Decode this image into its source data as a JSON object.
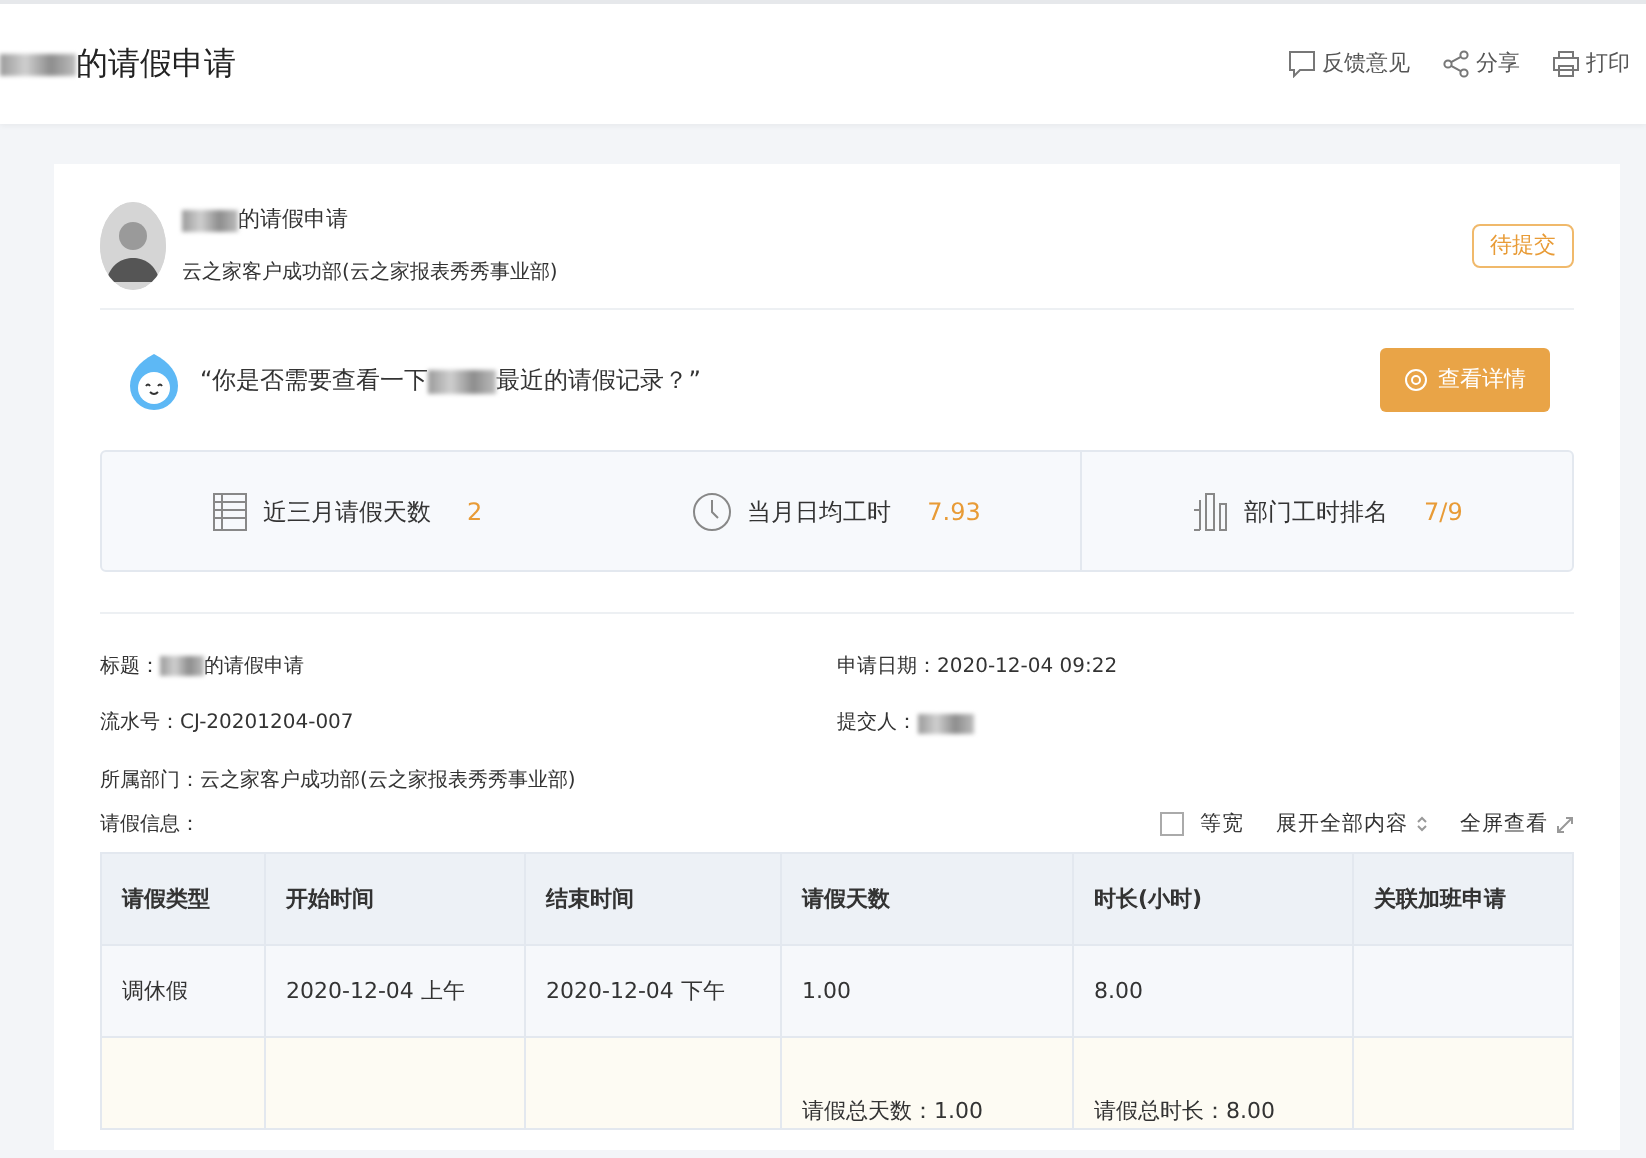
{
  "header": {
    "title": "的请假申请",
    "actions": [
      {
        "kind": "feedback",
        "label": "反馈意见"
      },
      {
        "kind": "share",
        "label": "分享"
      },
      {
        "kind": "print",
        "label": "打印"
      }
    ]
  },
  "applicant": {
    "title": "的请假申请",
    "department": "云之家客户成功部(云之家报表秀秀事业部)",
    "status": "待提交"
  },
  "assistant": {
    "before": "“你是否需要查看一下",
    "after": "最近的请假记录？”",
    "button": "查看详情"
  },
  "stats": [
    {
      "kind": "calendar",
      "label": "近三月请假天数",
      "value": "2"
    },
    {
      "kind": "clock",
      "label": "当月日均工时",
      "value": "7.93"
    },
    {
      "kind": "rank",
      "label": "部门工时排名",
      "value": "7/9"
    }
  ],
  "details": [
    {
      "label": "标题：",
      "value": "的请假申请",
      "redacted": true
    },
    {
      "label": "申请日期：",
      "value": "2020-12-04 09:22",
      "redacted": false
    },
    {
      "label": "流水号：",
      "value": "CJ-20201204-007",
      "redacted": false
    },
    {
      "label": "提交人：",
      "redacted": true
    },
    {
      "label": "所属部门：",
      "value": "云之家客户成功部(云之家报表秀秀事业部)",
      "redacted": false
    }
  ],
  "leave_info": {
    "label": "请假信息：",
    "equal_width": {
      "label": "等宽",
      "checked": false
    },
    "expand": "展开全部内容",
    "fullscreen": "全屏查看"
  },
  "table": {
    "columns": [
      "请假类型",
      "开始时间",
      "结束时间",
      "请假天数",
      "时长(小时)",
      "关联加班申请"
    ],
    "rows": [
      [
        "调休假",
        "2020-12-04 上午",
        "2020-12-04 下午",
        "1.00",
        "8.00",
        ""
      ]
    ],
    "summary": {
      "days": "请假总天数：1.00",
      "hours": "请假总时长：8.00"
    }
  }
}
